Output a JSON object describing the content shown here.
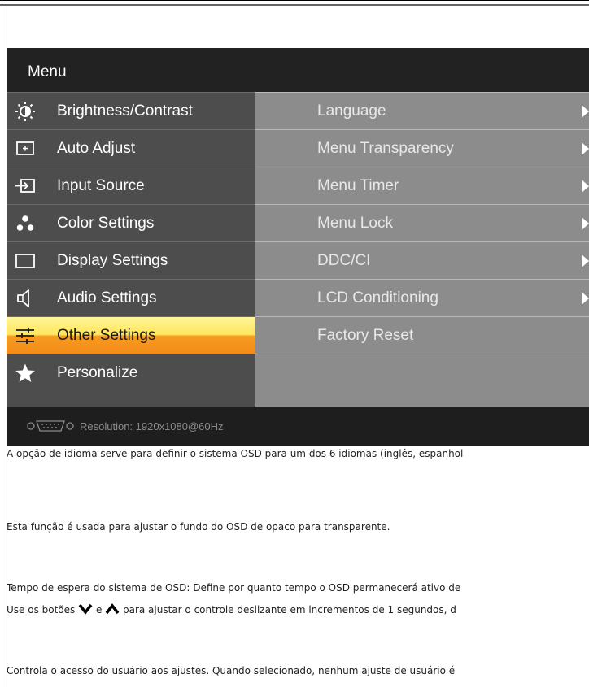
{
  "osd": {
    "title": "Menu",
    "menu_items": [
      {
        "label": "Brightness/Contrast",
        "icon": "brightness-icon"
      },
      {
        "label": "Auto Adjust",
        "icon": "auto-adjust-icon"
      },
      {
        "label": "Input Source",
        "icon": "input-source-icon"
      },
      {
        "label": "Color Settings",
        "icon": "color-settings-icon"
      },
      {
        "label": "Display Settings",
        "icon": "display-settings-icon"
      },
      {
        "label": "Audio Settings",
        "icon": "speaker-icon"
      },
      {
        "label": "Other Settings",
        "icon": "sliders-icon",
        "selected": true
      },
      {
        "label": "Personalize",
        "icon": "star-icon"
      }
    ],
    "sub_items": [
      {
        "label": "Language",
        "has_arrow": true
      },
      {
        "label": "Menu Transparency",
        "has_arrow": true
      },
      {
        "label": "Menu Timer",
        "has_arrow": true
      },
      {
        "label": "Menu Lock",
        "has_arrow": true
      },
      {
        "label": "DDC/CI",
        "has_arrow": true
      },
      {
        "label": "LCD Conditioning",
        "has_arrow": true
      },
      {
        "label": "Factory Reset",
        "has_arrow": false
      }
    ],
    "footer": {
      "resolution": "Resolution:  1920x1080@60Hz",
      "connector_icon": "vga-connector-icon"
    },
    "colors": {
      "selected_top": "#fff59a",
      "selected_bottom": "#f58c1a",
      "left_bg": "#4d4d4d",
      "right_bg": "#8c8c8c"
    }
  },
  "descriptions": {
    "language": "A opção de idioma serve para definir o sistema OSD para um dos 6 idiomas (inglês, espanhol",
    "transparency": "Esta função é usada para ajustar o fundo do OSD de opaco para transparente.",
    "timer_1": "Tempo de espera do sistema de OSD: Define por quanto tempo o OSD permanecerá ativo de",
    "timer_2_a": "Use os botões",
    "timer_2_b": "e",
    "timer_2_c": "para ajustar o controle deslizante em incrementos de 1 segundos, d",
    "lock": "Controla o acesso do usuário aos ajustes. Quando selecionado, nenhum ajuste de usuário é"
  }
}
